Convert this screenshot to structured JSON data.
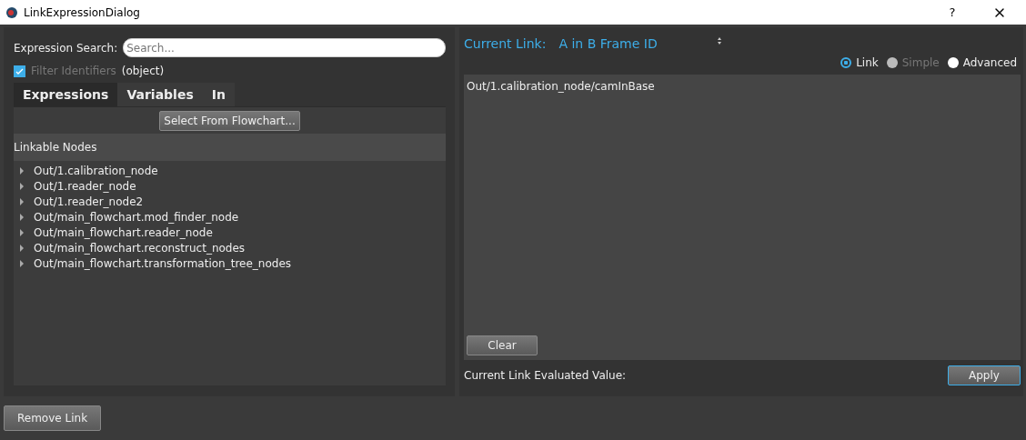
{
  "window": {
    "title": "LinkExpressionDialog",
    "help": "?"
  },
  "left": {
    "search": {
      "label": "Expression Search:",
      "placeholder": "Search..."
    },
    "filter": {
      "label": "Filter Identifiers",
      "checked": true,
      "disabled": true,
      "type_text": "(object)"
    },
    "tabs": [
      {
        "label": "Expressions",
        "selected": true
      },
      {
        "label": "Variables",
        "selected": false
      },
      {
        "label": "In",
        "selected": false
      }
    ],
    "select_button": "Select From Flowchart...",
    "tree_header": "Linkable Nodes",
    "tree": [
      {
        "label": "Out/1.calibration_node",
        "expanded": false
      },
      {
        "label": "Out/1.reader_node",
        "expanded": false
      },
      {
        "label": "Out/1.reader_node2",
        "expanded": false
      },
      {
        "label": "Out/main_flowchart.mod_finder_node",
        "expanded": false
      },
      {
        "label": "Out/main_flowchart.reader_node",
        "expanded": false
      },
      {
        "label": "Out/main_flowchart.reconstruct_nodes",
        "expanded": false
      },
      {
        "label": "Out/main_flowchart.transformation_tree_nodes",
        "expanded": false
      }
    ]
  },
  "right": {
    "current_link": {
      "label": "Current Link:",
      "value": "A in B Frame ID"
    },
    "modes": [
      {
        "label": "Link",
        "selected": true,
        "disabled": false
      },
      {
        "label": "Simple",
        "selected": false,
        "disabled": true
      },
      {
        "label": "Advanced",
        "selected": false,
        "disabled": false
      }
    ],
    "expression": "Out/1.calibration_node/camInBase",
    "clear_button": "Clear",
    "evaluated_label": "Current Link Evaluated Value:",
    "apply_button": "Apply"
  },
  "remove_button": "Remove Link"
}
